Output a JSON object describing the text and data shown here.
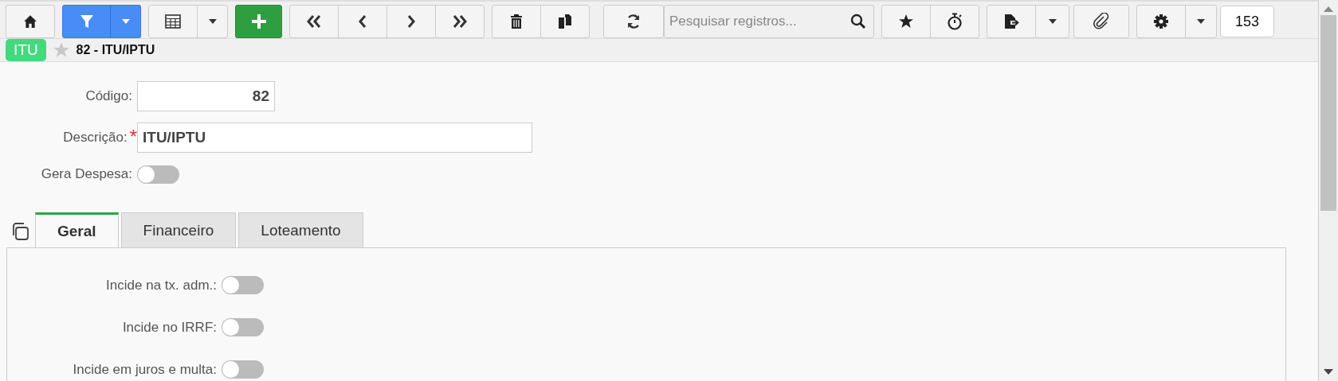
{
  "toolbar": {
    "search": {
      "placeholder": "Pesquisar registros..."
    },
    "counter": "153"
  },
  "header": {
    "badge": "ITU",
    "favorite": false,
    "title": "82 - ITU/IPTU"
  },
  "form": {
    "fields": [
      {
        "kind": "number",
        "label": "Código:",
        "value": "82"
      },
      {
        "kind": "text",
        "label": "Descrição:",
        "value": "ITU/IPTU",
        "required_mark": "*"
      },
      {
        "kind": "toggle",
        "label": "Gera Despesa:",
        "on": false
      }
    ]
  },
  "tabs": [
    {
      "label": "Geral",
      "selected": true
    },
    {
      "label": "Financeiro",
      "selected": false
    },
    {
      "label": "Loteamento",
      "selected": false
    }
  ],
  "tab_panel": {
    "fields": [
      {
        "label": "Incide na tx. adm.:",
        "on": false
      },
      {
        "label": "Incide no IRRF:",
        "on": false
      },
      {
        "label": "Incide em juros e multa:",
        "on": false
      }
    ]
  }
}
